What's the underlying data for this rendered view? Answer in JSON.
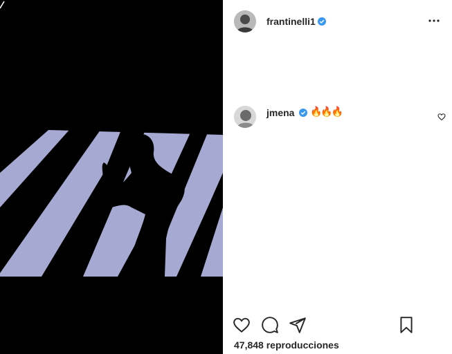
{
  "post": {
    "author": {
      "username": "frantinelli1",
      "verified": true
    },
    "more_icon": "more-options-icon"
  },
  "comments": [
    {
      "username": "jmena",
      "verified": true,
      "text": "🔥🔥🔥"
    }
  ],
  "actions": {
    "like_icon": "heart-icon",
    "comment_icon": "comment-icon",
    "share_icon": "paper-plane-icon",
    "save_icon": "bookmark-icon"
  },
  "stats": {
    "views_count": "47,848",
    "views_label": "reproducciones"
  },
  "colors": {
    "verified_blue": "#3897f0",
    "text": "#262626",
    "media_light": "#a6a9d2"
  }
}
